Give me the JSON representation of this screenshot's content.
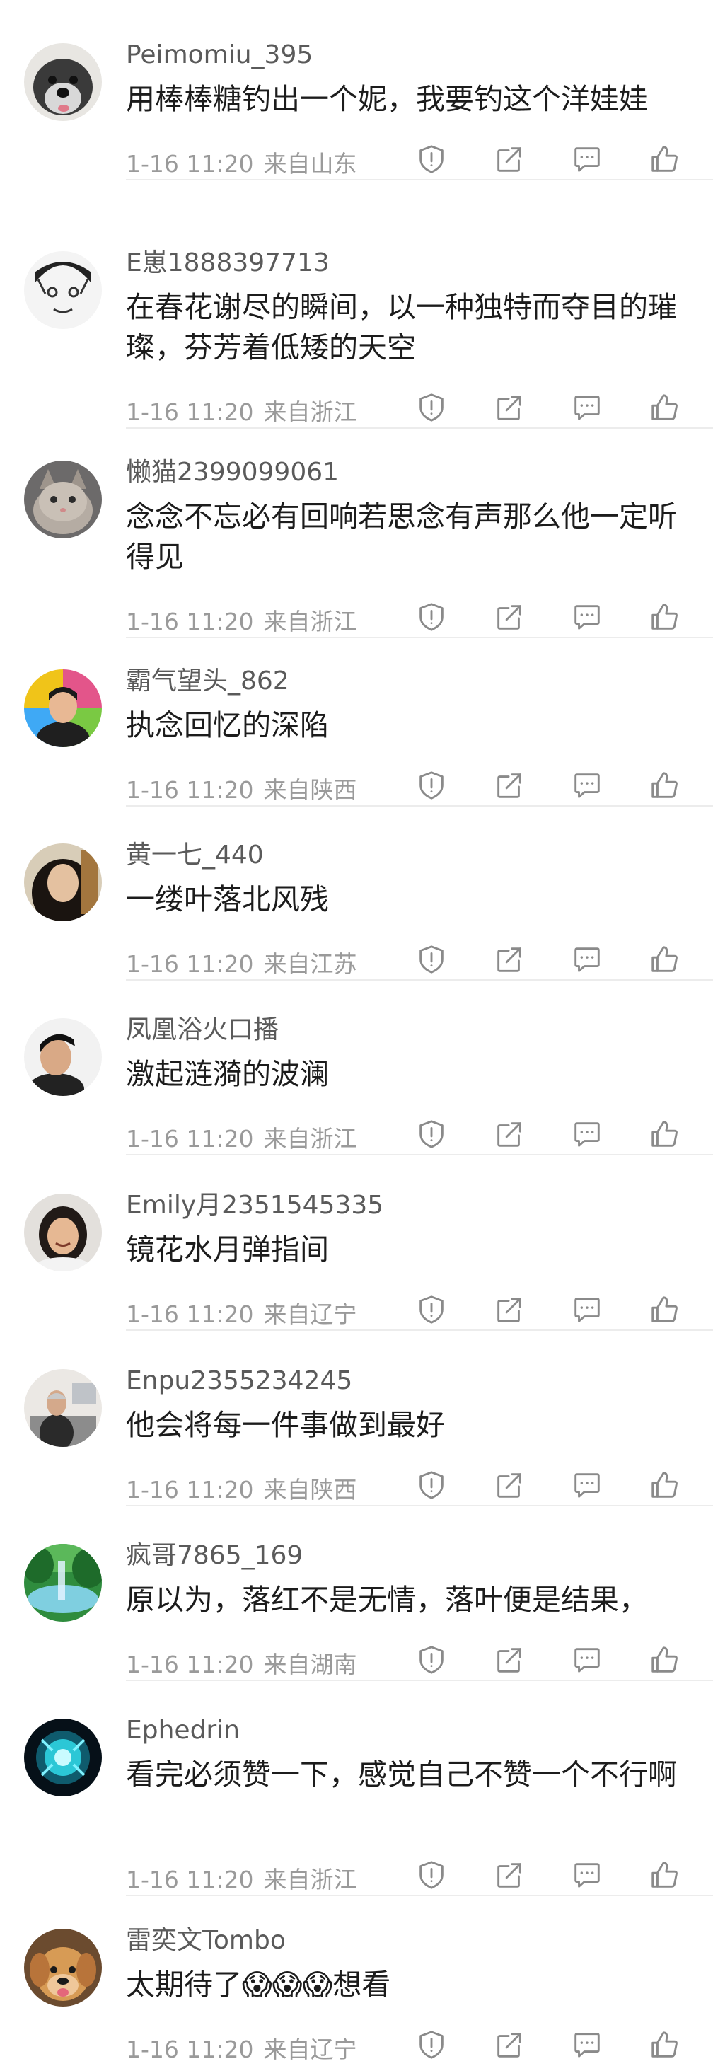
{
  "comments": [
    {
      "username": "Peimomiu_395",
      "text": "用棒棒糖钓出一个妮，我要钓这个洋娃娃",
      "time": "1-16 11:20",
      "location": "来自山东",
      "avatar_icon": "schnauzer-dog-avatar"
    },
    {
      "username": "E崽1888397713",
      "text": "在春花谢尽的瞬间，以一种独特而夺目的璀璨，芬芳着低矮的天空",
      "time": "1-16 11:20",
      "location": "来自浙江",
      "avatar_icon": "cartoon-face-avatar"
    },
    {
      "username": "懒猫2399099061",
      "text": "念念不忘必有回响若思念有声那么他一定听得见",
      "time": "1-16 11:20",
      "location": "来自浙江",
      "avatar_icon": "cat-avatar"
    },
    {
      "username": "霸气望头_862",
      "text": "执念回忆的深陷",
      "time": "1-16 11:20",
      "location": "来自陕西",
      "avatar_icon": "man-colorful-bg-avatar"
    },
    {
      "username": "黄一七_440",
      "text": "一缕叶落北风残",
      "time": "1-16 11:20",
      "location": "来自江苏",
      "avatar_icon": "woman-portrait-avatar"
    },
    {
      "username": "凤凰浴火口播",
      "text": "激起涟漪的波澜",
      "time": "1-16 11:20",
      "location": "来自浙江",
      "avatar_icon": "man-dark-hair-avatar"
    },
    {
      "username": "Emily月2351545335",
      "text": "镜花水月弹指间",
      "time": "1-16 11:20",
      "location": "来自辽宁",
      "avatar_icon": "girl-smiling-avatar"
    },
    {
      "username": "Enpu2355234245",
      "text": "他会将每一件事做到最好",
      "time": "1-16 11:20",
      "location": "来自陕西",
      "avatar_icon": "man-office-avatar"
    },
    {
      "username": "疯哥7865_169",
      "text": "原以为，落红不是无情，落叶便是结果，",
      "time": "1-16 11:20",
      "location": "来自湖南",
      "avatar_icon": "green-landscape-avatar"
    },
    {
      "username": "Ephedrin",
      "text": "看完必须赞一下，感觉自己不赞一个不行啊",
      "time": "1-16 11:20",
      "location": "来自浙江",
      "avatar_icon": "blue-energy-orb-avatar"
    },
    {
      "username": "雷奕文Tombo",
      "text": "太期待了😱😱😱想看",
      "time": "1-16 11:20",
      "location": "来自辽宁",
      "avatar_icon": "golden-puppy-avatar"
    }
  ],
  "icon_color": "#8a8a8a",
  "divider_color": "#ececec"
}
